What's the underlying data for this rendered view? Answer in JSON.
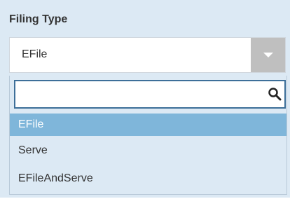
{
  "field": {
    "label": "Filing Type",
    "selected_value": "EFile"
  },
  "search": {
    "value": "",
    "placeholder": "",
    "icon": "search-icon"
  },
  "dropdown": {
    "options": [
      "EFile",
      "Serve",
      "EFileAndServe"
    ],
    "highlighted_option": "EFile",
    "arrow_icon": "chevron-down-icon"
  },
  "colors": {
    "panel_background": "#dce9f4",
    "highlight": "#7fb6da",
    "search_border": "#3d6f99",
    "arrow_button": "#bfbfbf"
  }
}
